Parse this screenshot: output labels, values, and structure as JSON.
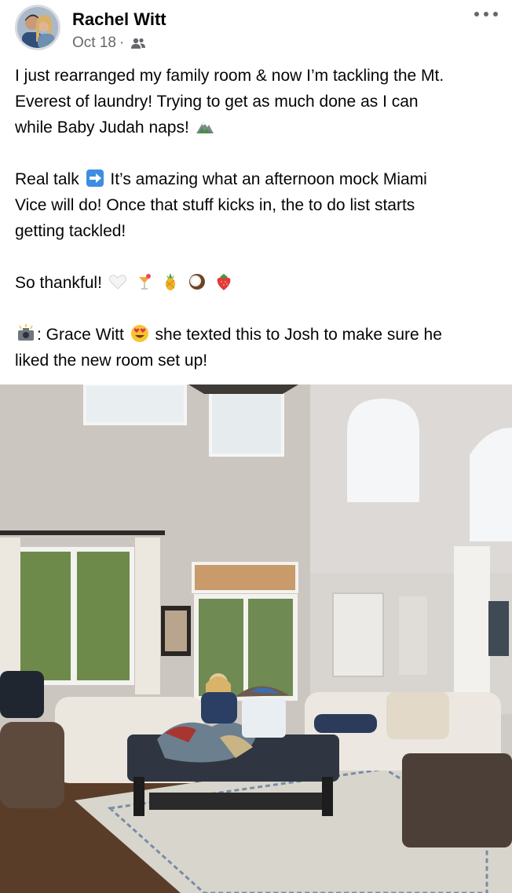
{
  "post": {
    "author": "Rachel Witt",
    "date": "Oct 18",
    "separator": "·",
    "audience_icon": "friends-icon",
    "more_icon": "more-options-icon",
    "paragraphs": [
      {
        "lines": [
          "I just rearranged my family room & now I’m tackling the Mt.",
          "Everest of laundry! Trying to get as much done as I can",
          "while Baby Judah naps!"
        ],
        "trailing_emoji": [
          "mountain-emoji"
        ]
      },
      {
        "lead_text": "Real talk",
        "lead_emoji": "right-arrow-emoji",
        "lines": [
          "It’s amazing what an afternoon mock Miami",
          "Vice will do! Once that stuff kicks in, the to do list starts",
          "getting tackled!"
        ]
      },
      {
        "text": "So thankful!",
        "trailing_emoji": [
          "white-heart-emoji",
          "tropical-drink-emoji",
          "pineapple-emoji",
          "coconut-emoji",
          "strawberry-emoji"
        ]
      },
      {
        "lead_emoji": "camera-flash-emoji",
        "lead_text": ": Grace Witt",
        "mid_emoji": "heart-eyes-emoji",
        "rest_first": "she texted this to Josh to make sure he",
        "rest_second": "liked the new room set up!"
      }
    ]
  },
  "colors": {
    "text": "#050505",
    "meta": "#65676b",
    "background": "#ffffff"
  }
}
